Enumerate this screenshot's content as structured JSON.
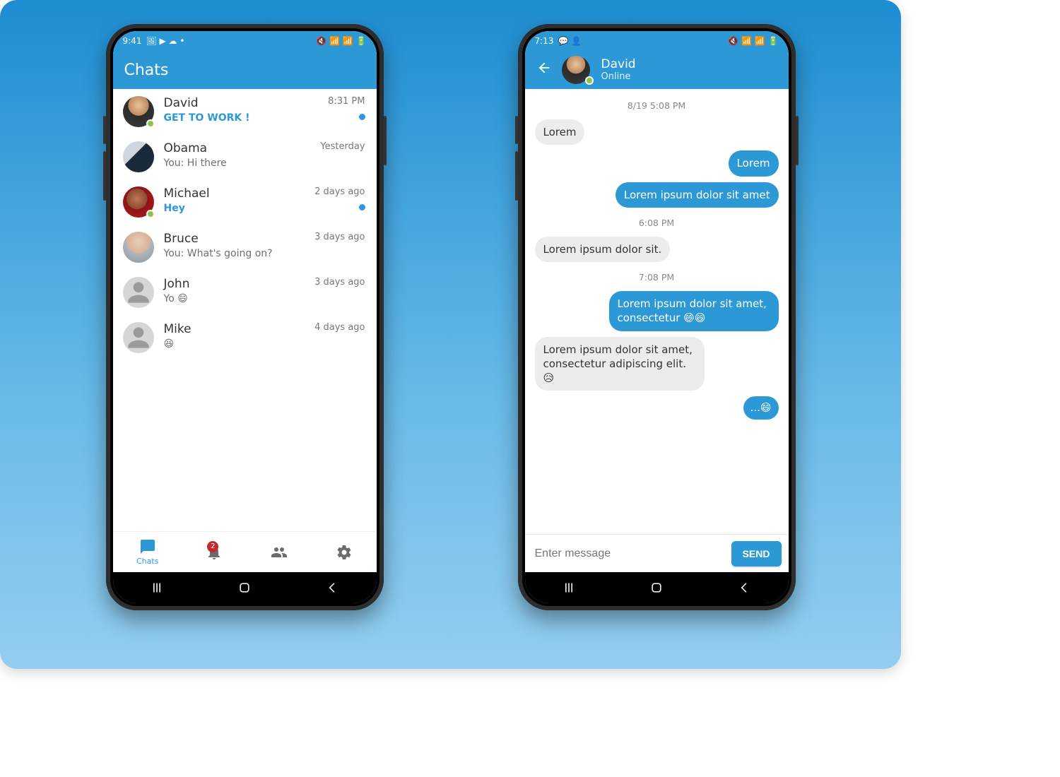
{
  "phone1": {
    "statusbar": {
      "time": "9:41",
      "icons_left": "🖼 ▶ ☁ •",
      "icons_right": "🔇 📶 📶 🔋"
    },
    "appbar": {
      "title": "Chats"
    },
    "chats": [
      {
        "name": "David",
        "preview": "GET TO WORK !",
        "time": "8:31 PM",
        "unread": true,
        "online": true,
        "avatar": "david"
      },
      {
        "name": "Obama",
        "preview": "You: Hi there",
        "time": "Yesterday",
        "unread": false,
        "online": false,
        "avatar": "obama"
      },
      {
        "name": "Michael",
        "preview": "Hey",
        "time": "2 days ago",
        "unread": true,
        "online": true,
        "avatar": "michael"
      },
      {
        "name": "Bruce",
        "preview": "You: What's going on?",
        "time": "3 days ago",
        "unread": false,
        "online": false,
        "avatar": "bruce"
      },
      {
        "name": "John",
        "preview": "Yo 😄",
        "time": "3 days ago",
        "unread": false,
        "online": false,
        "avatar": ""
      },
      {
        "name": "Mike",
        "preview": "😆",
        "time": "4 days ago",
        "unread": false,
        "online": false,
        "avatar": ""
      }
    ],
    "tabs": {
      "chats_label": "Chats",
      "notif_badge": "2"
    }
  },
  "phone2": {
    "statusbar": {
      "time": "7:13",
      "icons_left": "💬 👤",
      "icons_right": "🔇 📶 📶 🔋"
    },
    "appbar": {
      "contact_name": "David",
      "contact_status": "Online"
    },
    "conversation": [
      {
        "ts": "8/19 5:08 PM"
      },
      {
        "side": "in",
        "text": "Lorem"
      },
      {
        "side": "out",
        "text": "Lorem"
      },
      {
        "side": "out",
        "text": "Lorem ipsum dolor sit amet"
      },
      {
        "ts": "6:08 PM"
      },
      {
        "side": "in",
        "text": "Lorem ipsum dolor sit."
      },
      {
        "ts": "7:08 PM"
      },
      {
        "side": "out",
        "text": "Lorem ipsum dolor sit amet, consectetur 😄😄"
      },
      {
        "side": "in",
        "text": "Lorem ipsum dolor sit amet, consectetur adipiscing elit. 😥"
      },
      {
        "side": "out",
        "text": "...😄",
        "small": true
      }
    ],
    "composer": {
      "placeholder": "Enter message",
      "send_label": "SEND"
    }
  }
}
